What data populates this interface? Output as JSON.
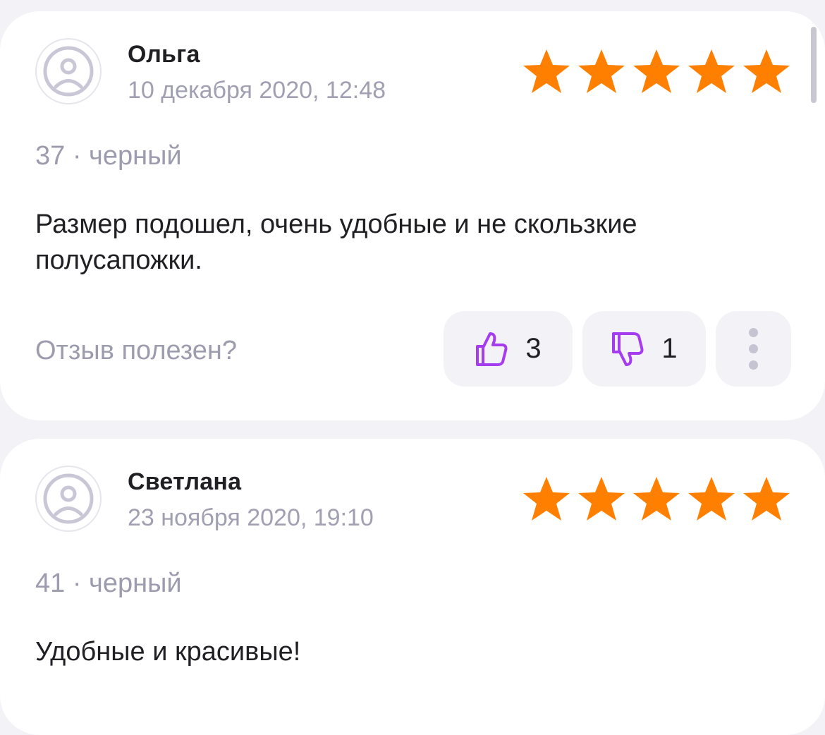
{
  "reviews": [
    {
      "author": "Ольга",
      "date": "10 декабря 2020, 12:48",
      "rating": 5,
      "variant": "37 · черный",
      "text": "Размер подошел, очень удобные и не скользкие полусапожки.",
      "helpful_label": "Отзыв полезен?",
      "likes": "3",
      "dislikes": "1"
    },
    {
      "author": "Светлана",
      "date": "23 ноября 2020, 19:10",
      "rating": 5,
      "variant": "41 · черный",
      "text": "Удобные и красивые!"
    }
  ],
  "icons": {
    "avatar": "default-avatar-icon",
    "star": "star-icon",
    "like": "thumbs-up-icon",
    "dislike": "thumbs-down-icon",
    "more": "more-vertical-icon"
  },
  "colors": {
    "star": "#ff8000",
    "accent": "#a63cf0",
    "muted_text": "#9d9bae",
    "button_bg": "#f3f2f6"
  }
}
